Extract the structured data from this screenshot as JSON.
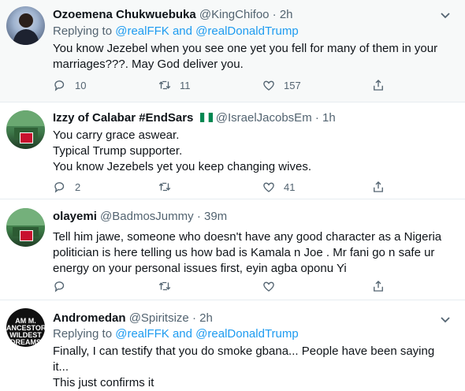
{
  "tweets": [
    {
      "name": "Ozoemena Chukwuebuka",
      "handle": "@KingChifoo",
      "time": "2h",
      "replying_prefix": "Replying to",
      "replying_to_1": "@realFFK",
      "replying_and": "and",
      "replying_to_2": "@realDonaldTrump",
      "text_line_1": "You know Jezebel when you see one yet you fell for many of them in your",
      "text_line_2": "marriages???. May God deliver you.",
      "replies": "10",
      "retweets": "11",
      "likes": "157"
    },
    {
      "name": "Izzy of Calabar #EndSars",
      "handle": "@IsraelJacobsEm",
      "time": "1h",
      "text_line_1": "You carry grace aswear.",
      "text_line_2": "Typical Trump supporter.",
      "text_line_3": "You know Jezebels yet you keep changing wives.",
      "replies": "2",
      "retweets": "",
      "likes": "41"
    },
    {
      "name": "olayemi",
      "handle": "@BadmosJummy",
      "time": "39m",
      "text_line_1": "Tell him jawe, someone who doesn't have any  good character  as a Nigeria",
      "text_line_2": "politician is here telling us how bad is Kamala n Joe . Mr fani go n safe ur",
      "text_line_3": "energy on your personal issues first, eyin agba oponu Yi",
      "replies": "",
      "retweets": "",
      "likes": ""
    },
    {
      "name": "Andromedan",
      "handle": "@Spiritsize",
      "time": "2h",
      "replying_prefix": "Replying to",
      "replying_to_1": "@realFFK",
      "replying_and": "and",
      "replying_to_2": "@realDonaldTrump",
      "text_line_1": "Finally, I can testify that you do smoke gbana... People have been saying it...",
      "text_line_2": "This just confirms it",
      "avatar_text": "AM M. ANCESTORS WILDEST DREAMS"
    }
  ],
  "colors": {
    "accent": "#1d9bf0",
    "muted": "#536471",
    "text": "#0f1419"
  }
}
